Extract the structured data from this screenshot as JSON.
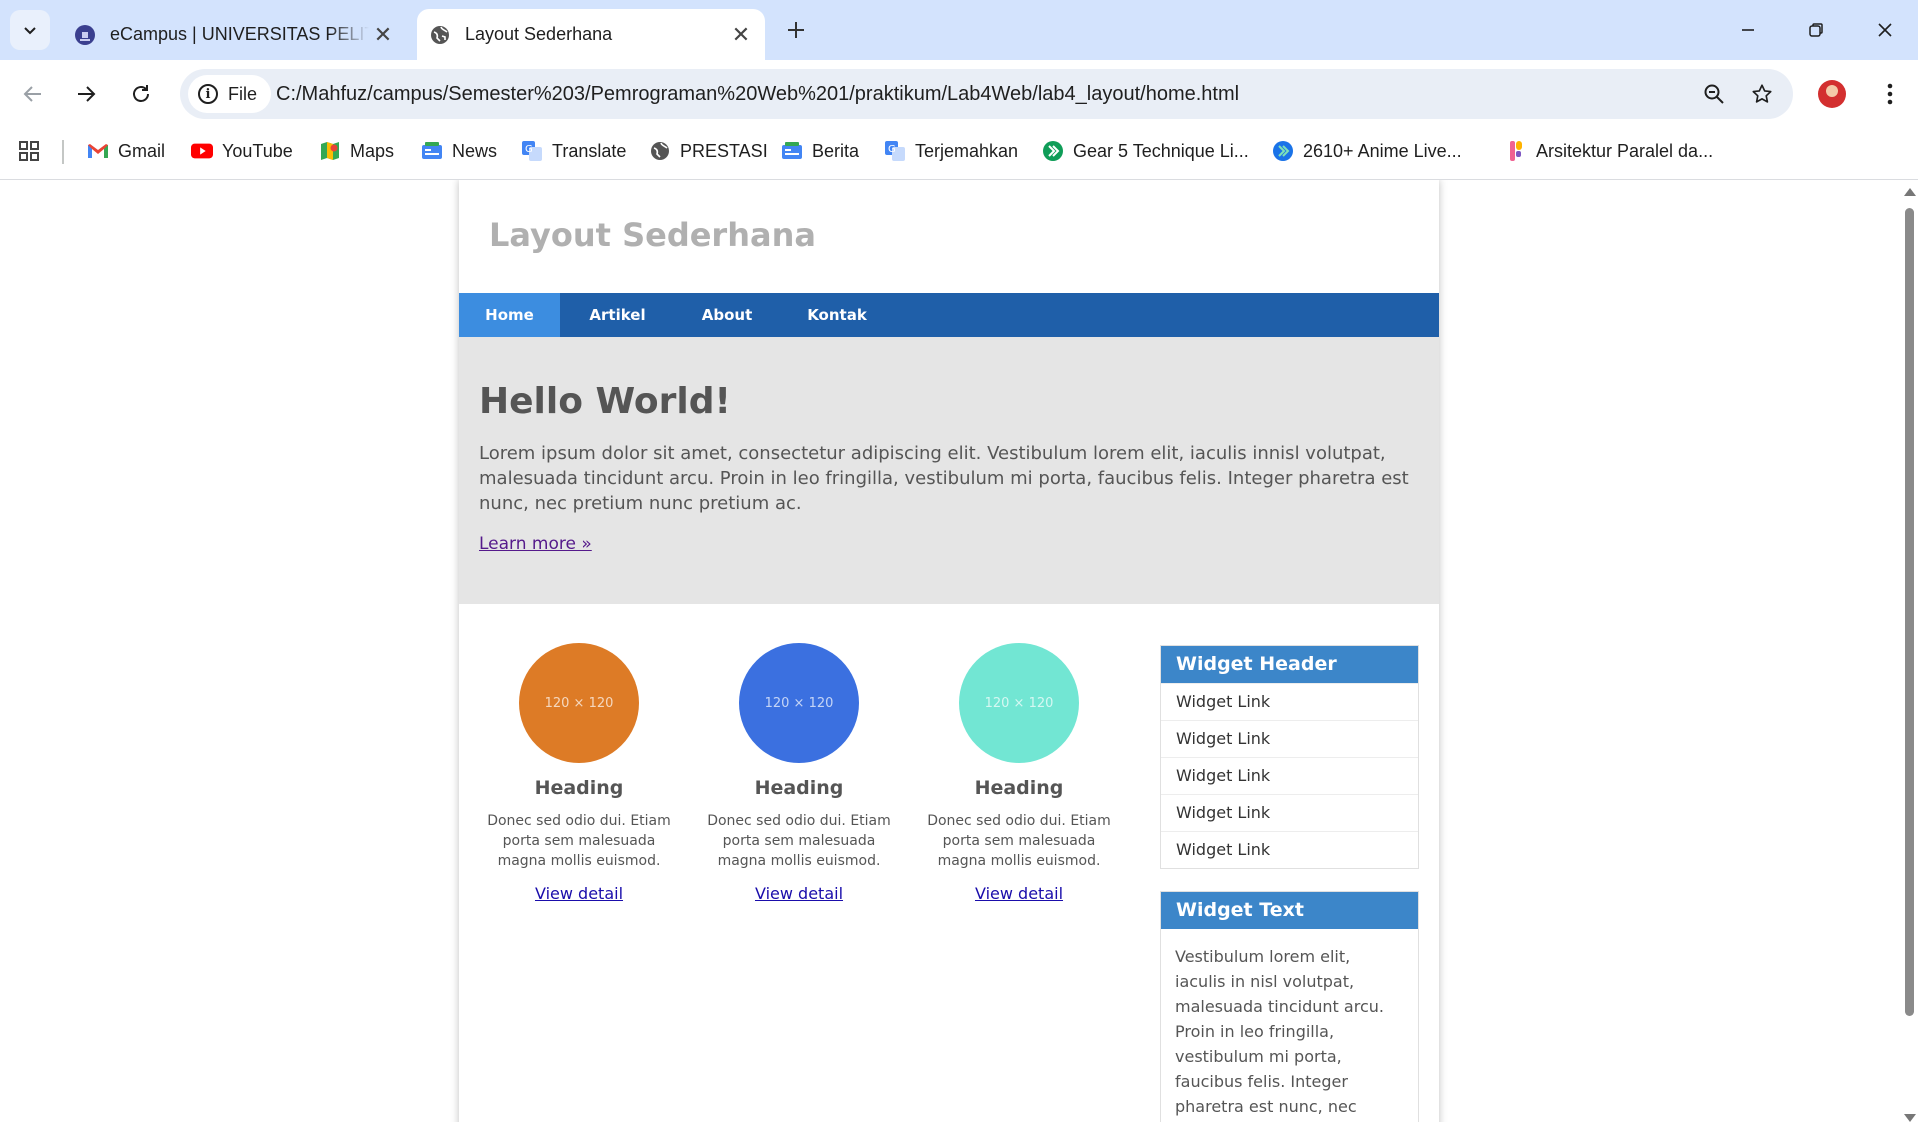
{
  "browser": {
    "tabs": [
      {
        "title": "eCampus | UNIVERSITAS PELITA",
        "active": false
      },
      {
        "title": "Layout Sederhana",
        "active": true
      }
    ],
    "address": {
      "chip_label": "File",
      "url": "C:/Mahfuz/campus/Semester%203/Pemrograman%20Web%201/praktikum/Lab4Web/lab4_layout/home.html"
    },
    "bookmarks": [
      {
        "label": "Gmail",
        "icon": "gmail-icon"
      },
      {
        "label": "YouTube",
        "icon": "youtube-icon"
      },
      {
        "label": "Maps",
        "icon": "maps-icon"
      },
      {
        "label": "News",
        "icon": "news-icon"
      },
      {
        "label": "Translate",
        "icon": "translate-icon"
      },
      {
        "label": "PRESTASI",
        "icon": "globe-icon"
      },
      {
        "label": "Berita",
        "icon": "news-icon"
      },
      {
        "label": "Terjemahkan",
        "icon": "translate-icon"
      },
      {
        "label": "Gear 5 Technique Li...",
        "icon": "bookmark-site-icon"
      },
      {
        "label": "2610+ Anime Live...",
        "icon": "bookmark-site-icon"
      },
      {
        "label": "Arsitektur Paralel da...",
        "icon": "bookmark-site-icon"
      }
    ]
  },
  "page": {
    "site_title": "Layout Sederhana",
    "nav": [
      {
        "label": "Home",
        "active": true
      },
      {
        "label": "Artikel",
        "active": false
      },
      {
        "label": "About",
        "active": false
      },
      {
        "label": "Kontak",
        "active": false
      }
    ],
    "hero": {
      "heading": "Hello World!",
      "text": "Lorem ipsum dolor sit amet, consectetur adipiscing elit. Vestibulum lorem elit, iaculis innisl volutpat, malesuada tincidunt arcu. Proin in leo fringilla, vestibulum mi porta, faucibus felis. Integer pharetra est nunc, nec pretium nunc pretium ac.",
      "link": "Learn more »"
    },
    "cards": [
      {
        "placeholder": "120 × 120",
        "color": "#dd7b26",
        "heading": "Heading",
        "text": "Donec sed odio dui. Etiam porta sem malesuada magna mollis euismod.",
        "link": "View detail"
      },
      {
        "placeholder": "120 × 120",
        "color": "#3b70e0",
        "heading": "Heading",
        "text": "Donec sed odio dui. Etiam porta sem malesuada magna mollis euismod.",
        "link": "View detail"
      },
      {
        "placeholder": "120 × 120",
        "color": "#72e6d3",
        "heading": "Heading",
        "text": "Donec sed odio dui. Etiam porta sem malesuada magna mollis euismod.",
        "link": "View detail"
      }
    ],
    "widgets": {
      "links_header": "Widget Header",
      "links": [
        "Widget Link",
        "Widget Link",
        "Widget Link",
        "Widget Link",
        "Widget Link"
      ],
      "text_header": "Widget Text",
      "text": "Vestibulum lorem elit, iaculis in nisl volutpat, malesuada tincidunt arcu. Proin in leo fringilla, vestibulum mi porta, faucibus felis. Integer pharetra est nunc, nec pretium nunc pretium ac."
    }
  },
  "colors": {
    "nav_bg": "#1f5fa9",
    "nav_active": "#3c8de0",
    "widget_header": "#3c86c9",
    "hero_bg": "#e5e5e5"
  }
}
